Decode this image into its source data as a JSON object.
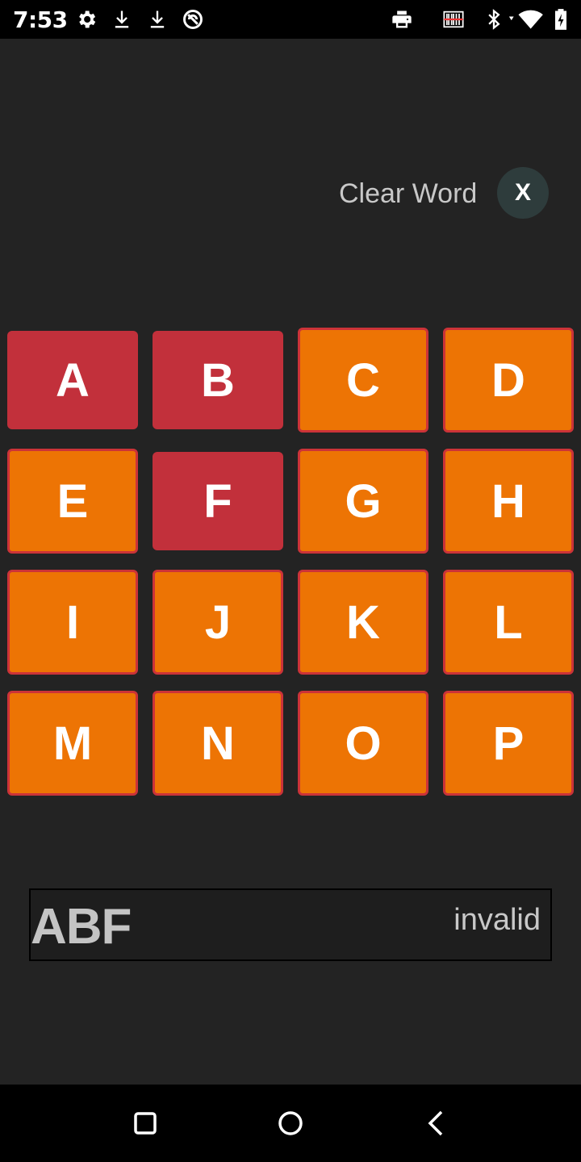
{
  "status_bar": {
    "time": "7:53",
    "icons": [
      "gear-icon",
      "download-icon",
      "download-icon",
      "no-disturb-icon",
      "print-icon",
      "barcode-icon",
      "bluetooth-icon",
      "wifi-icon",
      "battery-charging-icon"
    ]
  },
  "header": {
    "clear_label": "Clear Word",
    "clear_button": "X"
  },
  "grid": {
    "tiles": [
      {
        "letter": "A",
        "selected": true
      },
      {
        "letter": "B",
        "selected": true
      },
      {
        "letter": "C",
        "selected": false
      },
      {
        "letter": "D",
        "selected": false
      },
      {
        "letter": "E",
        "selected": false
      },
      {
        "letter": "F",
        "selected": true
      },
      {
        "letter": "G",
        "selected": false
      },
      {
        "letter": "H",
        "selected": false
      },
      {
        "letter": "I",
        "selected": false
      },
      {
        "letter": "J",
        "selected": false
      },
      {
        "letter": "K",
        "selected": false
      },
      {
        "letter": "L",
        "selected": false
      },
      {
        "letter": "M",
        "selected": false
      },
      {
        "letter": "N",
        "selected": false
      },
      {
        "letter": "O",
        "selected": false
      },
      {
        "letter": "P",
        "selected": false
      }
    ]
  },
  "word": {
    "current": "ABF",
    "status": "invalid"
  },
  "colors": {
    "selected_tile": "#c2303b",
    "unselected_tile": "#ed7404",
    "tile_border": "#cc3338",
    "background": "#232323"
  },
  "nav_bar": {
    "buttons": [
      "recents-icon",
      "home-icon",
      "back-icon"
    ]
  }
}
